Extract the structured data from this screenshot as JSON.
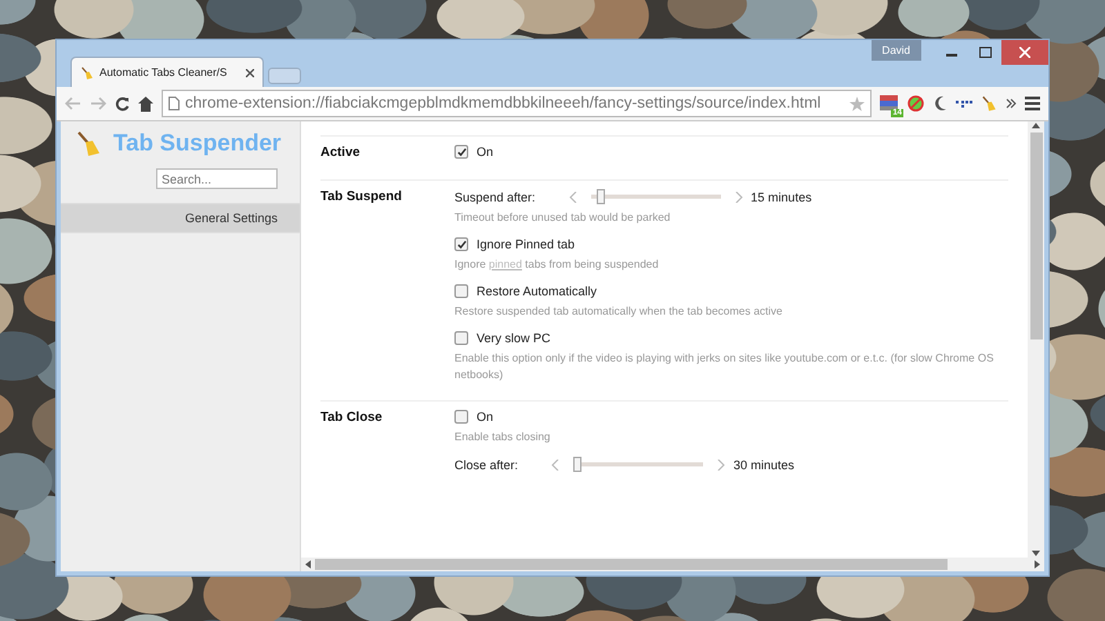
{
  "window": {
    "user": "David"
  },
  "tabs": [
    {
      "title": "Automatic Tabs Cleaner/S",
      "selected": true
    }
  ],
  "address_bar": {
    "url": "chrome-extension://fiabciakcmgepblmdkmemdbbkilneeeh/fancy-settings/source/index.html"
  },
  "extension_badge": "14",
  "sidebar": {
    "title": "Tab Suspender",
    "search": {
      "placeholder": "Search..."
    },
    "items": [
      {
        "label": "General Settings",
        "selected": true
      }
    ]
  },
  "sections": [
    {
      "heading": "Active",
      "items": [
        {
          "kind": "checkbox",
          "label": "On",
          "checked": true
        }
      ]
    },
    {
      "heading": "Tab Suspend",
      "items": [
        {
          "kind": "slider",
          "label": "Suspend after:",
          "level": 0.05,
          "reading": "15 minutes",
          "hint": "Timeout before unused tab would be parked"
        },
        {
          "kind": "checkbox",
          "label": "Ignore Pinned tab",
          "checked": true,
          "hint": [
            {
              "text": "Ignore ",
              "link": false
            },
            {
              "text": "pinned",
              "link": true
            },
            {
              "text": " tabs from being suspended",
              "link": false
            }
          ]
        },
        {
          "kind": "checkbox",
          "label": "Restore Automatically",
          "checked": false,
          "hint": "Restore suspended tab automatically when the tab becomes active"
        },
        {
          "kind": "checkbox",
          "label": "Very slow PC",
          "checked": false,
          "hint": "Enable this option only if the video is playing with jerks on sites like youtube.com or e.t.c. (for slow Chrome OS netbooks)"
        }
      ]
    },
    {
      "heading": "Tab Close",
      "items": [
        {
          "kind": "checkbox",
          "label": "On",
          "checked": false,
          "hint": "Enable tabs closing"
        },
        {
          "kind": "slider",
          "label": "Close after:",
          "level": 0.0,
          "reading": "30 minutes"
        }
      ]
    }
  ]
}
